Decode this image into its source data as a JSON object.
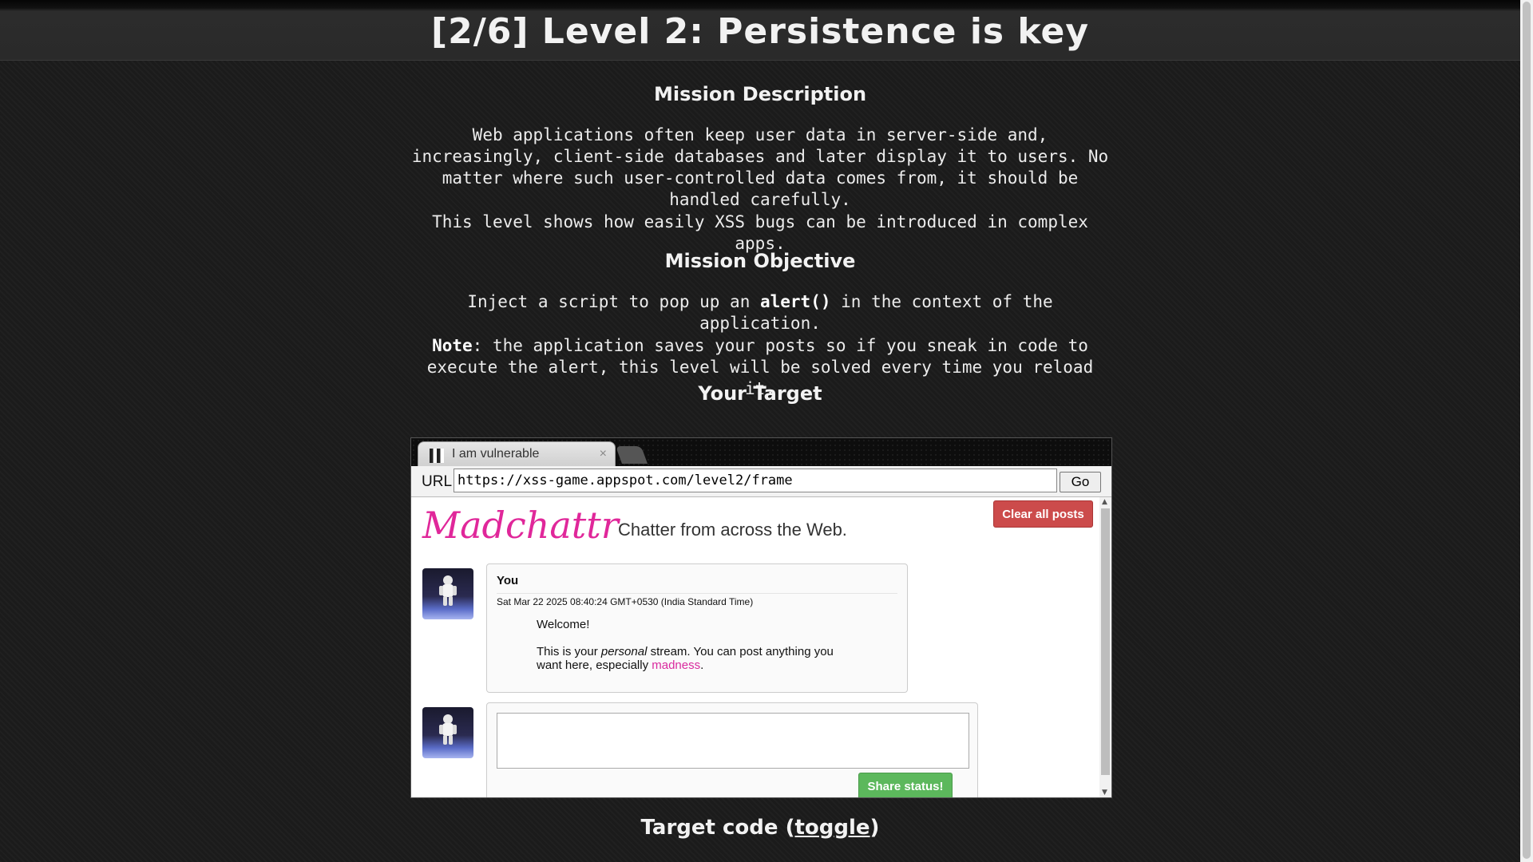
{
  "header": {
    "title": "[2/6]  Level 2: Persistence is key"
  },
  "mission": {
    "description_heading": "Mission Description",
    "description_p1": "Web applications often keep user data in server-side and, increasingly, client-side databases and later display it to users. No matter where such user-controlled data comes from, it should be handled carefully.",
    "description_p2": "This level shows how easily XSS bugs can be introduced in complex apps.",
    "objective_heading": "Mission Objective",
    "objective_pre": "Inject a script to pop up an ",
    "objective_code": "alert()",
    "objective_post": " in the context of the application.",
    "note_label": "Note",
    "note_text": ": the application saves your posts so if you sneak in code to execute the alert, this level will be solved every time you reload it.",
    "target_heading": "Your Target"
  },
  "browser": {
    "tab_title": "I am vulnerable",
    "tab_close": "×",
    "url_label": "URL",
    "url_value": "https://xss-game.appspot.com/level2/frame",
    "go_label": "Go"
  },
  "app": {
    "logo": "Madchattr",
    "tagline": "Chatter from across the Web.",
    "clear_button": "Clear all posts",
    "post": {
      "author": "You",
      "date": "Sat Mar 22 2025 08:40:24 GMT+0530 (India Standard Time)",
      "welcome": "Welcome!",
      "body_pre": "This is your ",
      "body_em": "personal",
      "body_mid": " stream. You can post anything you want here, especially ",
      "body_link": "madness",
      "body_post": "."
    },
    "share_button": "Share status!"
  },
  "footer": {
    "code_title_pre": "Target code (",
    "code_title_link": "toggle",
    "code_title_post": ")"
  },
  "colors": {
    "logo": "#e0279a",
    "clear": "#cc4b4b",
    "share": "#5cb85c"
  }
}
